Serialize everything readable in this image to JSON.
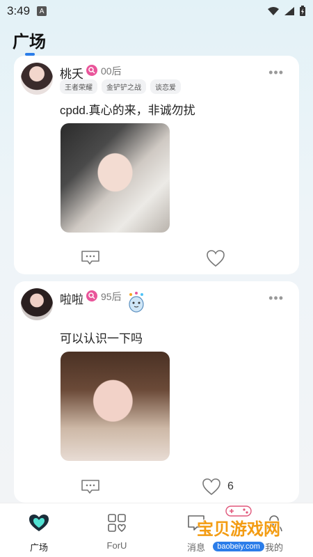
{
  "status_bar": {
    "time": "3:49",
    "notification_letter": "A"
  },
  "page": {
    "title": "广场"
  },
  "posts": [
    {
      "username": "桃夭",
      "age": "00后",
      "tags": [
        "王者荣耀",
        "金铲铲之战",
        "谈恋爱"
      ],
      "text": "cpdd.真心的来，非诚勿扰",
      "like_count": ""
    },
    {
      "username": "啦啦",
      "age": "95后",
      "tags": [],
      "text": "可以认识一下吗",
      "like_count": "6"
    }
  ],
  "bottom_nav": {
    "items": [
      {
        "label": "广场",
        "icon": "heart-chat-icon",
        "active": true
      },
      {
        "label": "ForU",
        "icon": "grid-heart-icon",
        "active": false
      },
      {
        "label": "消息",
        "icon": "message-icon",
        "active": false
      },
      {
        "label": "我的",
        "icon": "profile-icon",
        "active": false
      }
    ]
  },
  "watermark": {
    "main": "宝贝游戏网",
    "sub": "baobeiy.com"
  },
  "colors": {
    "accent": "#2b7de9",
    "badge": "#e9559a",
    "background": "#eef4f8"
  }
}
